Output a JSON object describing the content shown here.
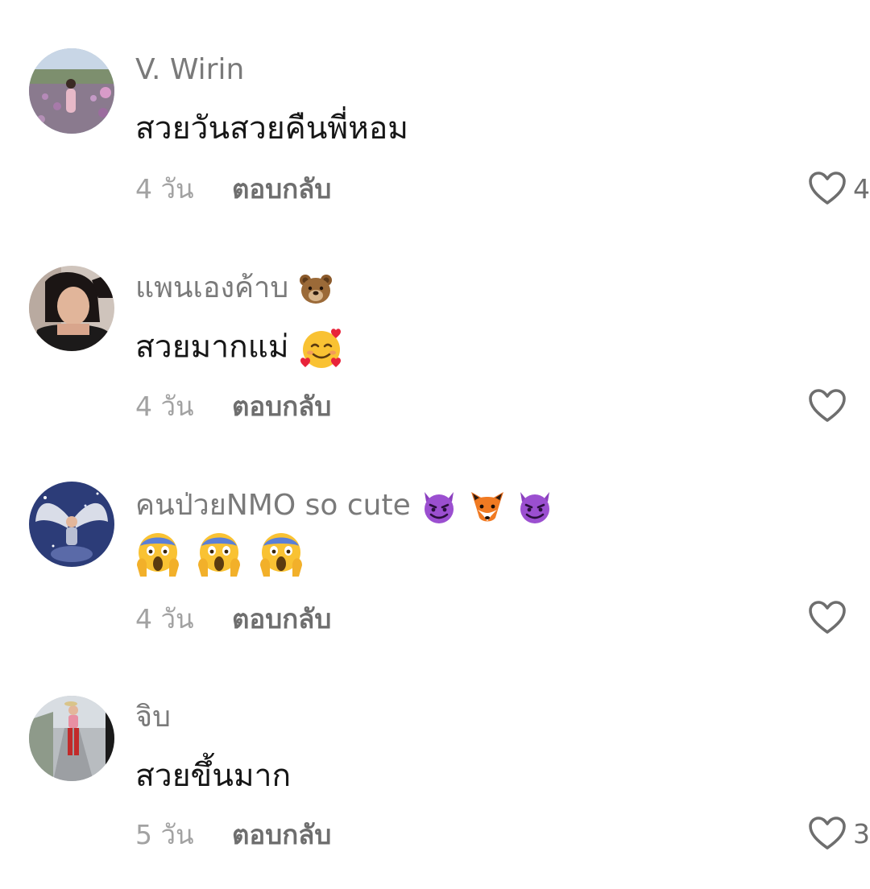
{
  "comments": [
    {
      "username": "V. Wirin",
      "username_emojis": [],
      "text": "สวยวันสวยคืนพี่หอม",
      "text_emojis": [],
      "time": "4 วัน",
      "reply_label": "ตอบกลับ",
      "like_icon": "heart-outline-icon",
      "like_count": "4"
    },
    {
      "username": "แพนเองค้าบ",
      "username_emojis": [
        "bear-emoji"
      ],
      "text": "สวยมากแม่",
      "text_emojis": [
        "smiling-face-with-hearts-emoji"
      ],
      "time": "4 วัน",
      "reply_label": "ตอบกลับ",
      "like_icon": "heart-outline-icon",
      "like_count": ""
    },
    {
      "username": "คนป่วยNMO so cute",
      "username_emojis": [
        "smiling-imp-emoji",
        "fox-emoji",
        "smiling-imp-emoji"
      ],
      "text": "",
      "text_emojis": [
        "scream-emoji",
        "scream-emoji",
        "scream-emoji"
      ],
      "time": "4 วัน",
      "reply_label": "ตอบกลับ",
      "like_icon": "heart-outline-icon",
      "like_count": ""
    },
    {
      "username": "จิบ",
      "username_emojis": [],
      "text": "สวยขึ้นมาก",
      "text_emojis": [],
      "time": "5 วัน",
      "reply_label": "ตอบกลับ",
      "like_icon": "heart-outline-icon",
      "like_count": "3"
    }
  ],
  "colors": {
    "username": "#7a7a7a",
    "body_text": "#161616",
    "time": "#a2a2a2",
    "reply": "#6e6e6e",
    "heart_outline": "#6e6e6e"
  }
}
